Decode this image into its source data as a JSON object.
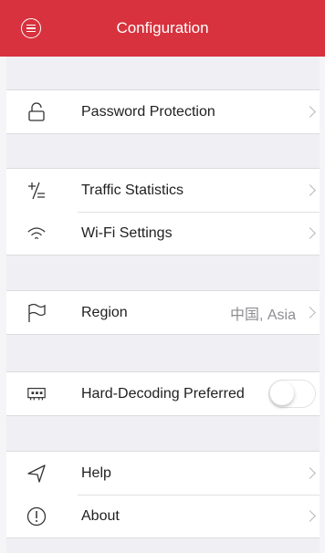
{
  "header": {
    "title": "Configuration",
    "menu_icon": "menu-icon",
    "color": "#d7323d"
  },
  "groups": [
    {
      "rows": [
        {
          "label": "Password Protection",
          "icon": "lock-icon"
        }
      ]
    },
    {
      "rows": [
        {
          "label": "Traffic Statistics",
          "icon": "plus-minus-icon"
        },
        {
          "label": "Wi-Fi Settings",
          "icon": "wifi-icon"
        }
      ]
    },
    {
      "rows": [
        {
          "label": "Region",
          "icon": "flag-icon",
          "value": "中国, Asia"
        }
      ]
    },
    {
      "rows": [
        {
          "label": "Hard-Decoding Preferred",
          "icon": "decoder-icon",
          "toggle_on": false
        }
      ]
    },
    {
      "rows": [
        {
          "label": "Help",
          "icon": "send-icon"
        },
        {
          "label": "About",
          "icon": "info-icon"
        }
      ]
    }
  ]
}
